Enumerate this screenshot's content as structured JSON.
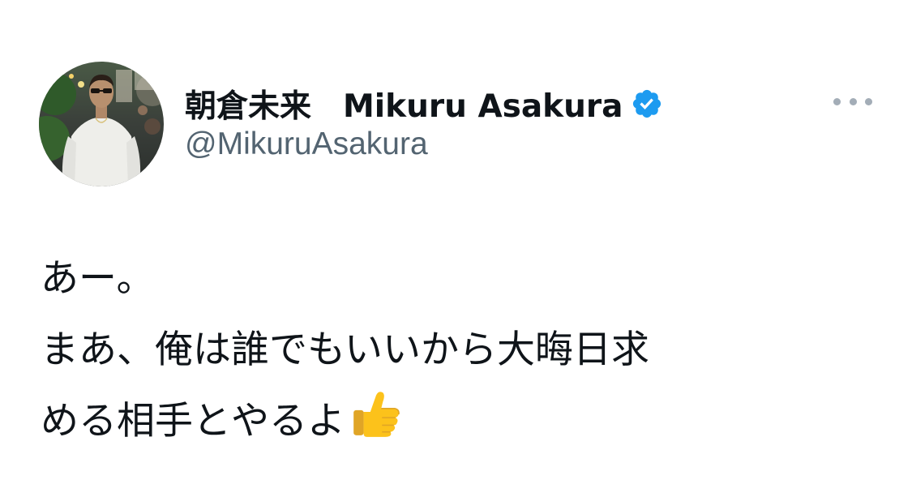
{
  "tweet": {
    "author": {
      "display_name": "朝倉未来　Mikuru Asakura",
      "handle": "@MikuruAsakura",
      "verified": true,
      "avatar_icon": "profile-photo"
    },
    "more_icon": "more-dots-icon",
    "text_lines": [
      "あー。",
      "まあ、俺は誰でもいいから大晦日求",
      "める相手とやるよ"
    ],
    "emoji": "👍",
    "emoji_icon": "thumbs-up-icon"
  },
  "colors": {
    "text": "#0f1419",
    "secondary": "#536471",
    "verified_blue": "#1d9bf0",
    "more_dots": "#a3adb7"
  }
}
